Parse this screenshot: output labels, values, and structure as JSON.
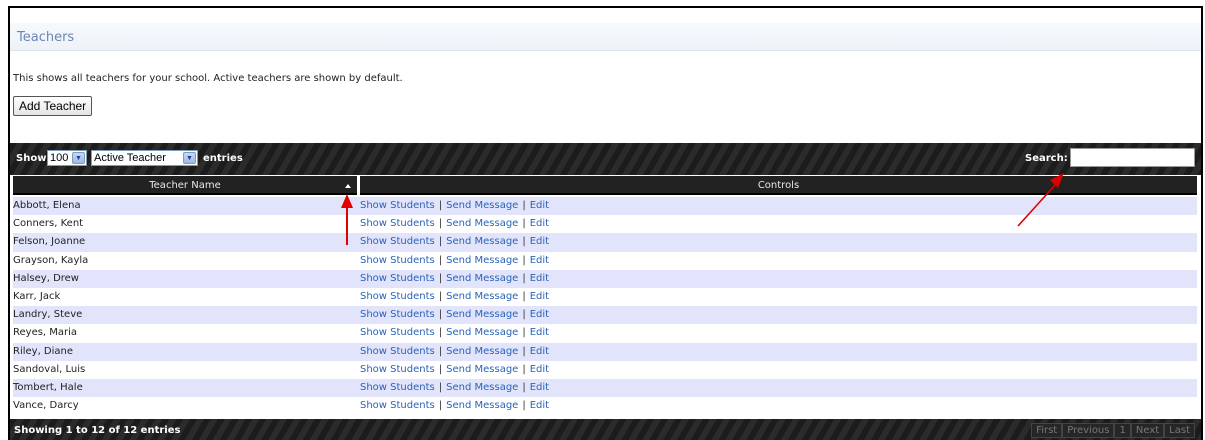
{
  "page": {
    "title": "Teachers",
    "intro": "This shows all teachers for your school. Active teachers are shown by default.",
    "add_button": "Add Teacher"
  },
  "toolbar": {
    "show_label": "Show",
    "length_value": "100",
    "filter_value": "Active Teacher",
    "entries_label": "entries",
    "search_label": "Search:",
    "search_value": ""
  },
  "table": {
    "columns": [
      "Teacher Name",
      "Controls"
    ],
    "sort": {
      "column": "Teacher Name",
      "direction": "ascending"
    },
    "control_links": [
      "Show Students",
      "Send Message",
      "Edit"
    ],
    "separator": "|",
    "rows": [
      "Abbott, Elena",
      "Conners, Kent",
      "Felson, Joanne",
      "Grayson, Kayla",
      "Halsey, Drew",
      "Karr, Jack",
      "Landry, Steve",
      "Reyes, Maria",
      "Riley, Diane",
      "Sandoval, Luis",
      "Tombert, Hale",
      "Vance, Darcy"
    ]
  },
  "footer": {
    "info": "Showing 1 to 12 of 12 entries",
    "pager": [
      "First",
      "Previous",
      "1",
      "Next",
      "Last"
    ]
  },
  "colors": {
    "title": "#6a86b3",
    "link": "#2a63b8",
    "row_alt": "#e2e4fb",
    "bar": "#1f1f1f",
    "annotation_arrow": "#e00000"
  },
  "icons": {
    "sort": "sort-asc-icon",
    "select_arrow": "chevron-down-icon"
  }
}
